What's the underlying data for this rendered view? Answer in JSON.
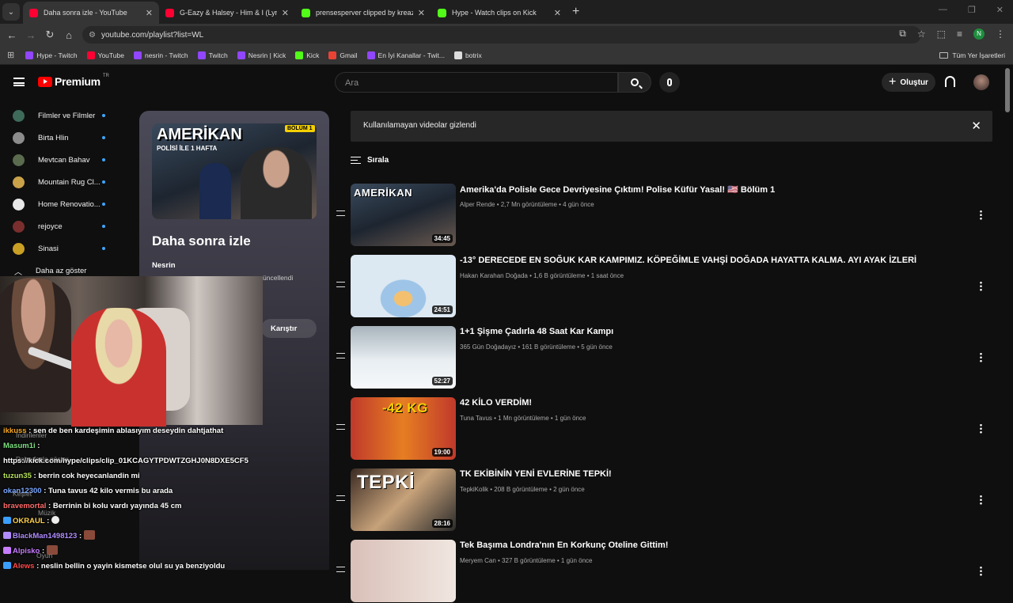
{
  "browser": {
    "tabs": [
      {
        "title": "Daha sonra izle - YouTube",
        "color": "#ff0033",
        "active": true
      },
      {
        "title": "G-Eazy & Halsey - Him & I (Lyri",
        "color": "#ff0033",
        "active": false
      },
      {
        "title": "prensesperver clipped by kreazi",
        "color": "#53fc18",
        "active": false
      },
      {
        "title": "Hype - Watch clips on Kick",
        "color": "#53fc18",
        "active": false
      }
    ],
    "url": "youtube.com/playlist?list=WL",
    "profile_initial": "N",
    "bookmarks": [
      {
        "label": "Hype - Twitch",
        "color": "#9146ff"
      },
      {
        "label": "YouTube",
        "color": "#ff0033"
      },
      {
        "label": "nesrin - Twitch",
        "color": "#9146ff"
      },
      {
        "label": "Twitch",
        "color": "#9146ff"
      },
      {
        "label": "Nesrin | Kick",
        "color": "#9146ff"
      },
      {
        "label": "Kick",
        "color": "#53fc18"
      },
      {
        "label": "Gmail",
        "color": "#ea4335"
      },
      {
        "label": "En İyi Kanallar - Twit...",
        "color": "#9146ff"
      },
      {
        "label": "botrix",
        "color": "#dddddd"
      }
    ],
    "bookmarks_folder": "Tüm Yer İşaretleri"
  },
  "youtube": {
    "logo_text": "Premium",
    "region": "TR",
    "search_placeholder": "Ara",
    "create_label": "Oluştur",
    "sidebar": {
      "channels": [
        {
          "name": "Filmler ve Filmler",
          "color": "#3e6a5a"
        },
        {
          "name": "Birta Hlin",
          "color": "#8c8c8c"
        },
        {
          "name": "Mevtcan Bahav",
          "color": "#5a6b4e"
        },
        {
          "name": "Mountain Rug Cl...",
          "color": "#c9a24a"
        },
        {
          "name": "Home Renovatio...",
          "color": "#e8e8e8"
        },
        {
          "name": "rejoyce",
          "color": "#7a2e2e"
        },
        {
          "name": "Sinasi",
          "color": "#c9a024"
        }
      ],
      "show_less": "Daha az göster"
    },
    "playlist": {
      "thumb_text": "AMERİKAN",
      "thumb_sub": "POLİSİ İLE 1 HAFTA",
      "thumb_badge": "BÖLÜM 1",
      "title": "Daha sonra izle",
      "owner": "Nesrin",
      "updated": "üncellendi",
      "shuffle": "Karıştır"
    },
    "banner": "Kullanılamayan videolar gizlendi",
    "sort_label": "Sırala",
    "videos": [
      {
        "title": "Amerika'da Polisle Gece Devriyesine Çıktım! Polise Küfür Yasal! 🇺🇸 Bölüm 1",
        "channel": "Alper Rende",
        "views": "2,7 Mn görüntüleme",
        "age": "4 gün önce",
        "duration": "34:45",
        "thumb_text": "AMERİKAN"
      },
      {
        "title": "-13° DERECEDE EN SOĞUK KAR KAMPIMIZ. KÖPEĞİMLE VAHŞİ DOĞADA HAYATTA KALMA. AYI AYAK İZLERİ",
        "channel": "Hakan Karahan Doğada",
        "views": "1,6 B görüntüleme",
        "age": "1 saat önce",
        "duration": "24:51",
        "thumb_text": ""
      },
      {
        "title": "1+1 Şişme Çadırla 48 Saat Kar Kampı",
        "channel": "365 Gün Doğadayız",
        "views": "161 B görüntüleme",
        "age": "5 gün önce",
        "duration": "52:27",
        "thumb_text": ""
      },
      {
        "title": "42 KİLO VERDİM!",
        "channel": "Tuna Tavus",
        "views": "1 Mn görüntüleme",
        "age": "1 gün önce",
        "duration": "19:00",
        "thumb_text": "-42 KG"
      },
      {
        "title": "TK EKİBİNİN YENİ EVLERİNE TEPKİ!",
        "channel": "TepkiKolik",
        "views": "208 B görüntüleme",
        "age": "2 gün önce",
        "duration": "28:16",
        "thumb_text": "TEPKİ"
      },
      {
        "title": "Tek Başıma Londra'nın En Korkunç Oteline Gittim!",
        "channel": "Meryem Can",
        "views": "327 B görüntüleme",
        "age": "1 gün önce",
        "duration": "",
        "thumb_text": ""
      }
    ]
  },
  "stream_overlay": {
    "chat": [
      {
        "user": "ikkuss",
        "color": "#f5a623",
        "text": "sen de ben kardeşimin ablasıyım deseydin dahtjathat"
      },
      {
        "user": "Masum1i",
        "color": "#7ee081",
        "text": ""
      },
      {
        "user": "",
        "color": "#ffffff",
        "text": "https://kick.com/hype/clips/clip_01KCAGYTPDWTZGHJ0N8DXE5CF5"
      },
      {
        "user": "tuzun35",
        "color": "#b6e05a",
        "text": "berrin cok heyecanlandin mi"
      },
      {
        "user": "okan12300",
        "color": "#7aa7ff",
        "text": "Tuna tavus 42 kilo vermis bu arada"
      },
      {
        "user": "bravemortal",
        "color": "#ff6b6b",
        "text": "Berrinin bi kolu vardı yayında 45 cm"
      },
      {
        "user": "OKRAUL",
        "color": "#ffd24a",
        "text": ""
      },
      {
        "user": "BlackMan1498123",
        "color": "#b08cff",
        "text": ""
      },
      {
        "user": "Alpisko",
        "color": "#c77dff",
        "text": ""
      },
      {
        "user": "Alews",
        "color": "#ff4a4a",
        "text": "neslin bellin o yayin kismetse olul su ya benziyoldu"
      }
    ],
    "ghost_labels": {
      "downloads": "İndirilenler",
      "show_more": "Daha fazla göster",
      "explore": "Keşfet",
      "music": "Müzik",
      "games": "Oyun"
    }
  }
}
